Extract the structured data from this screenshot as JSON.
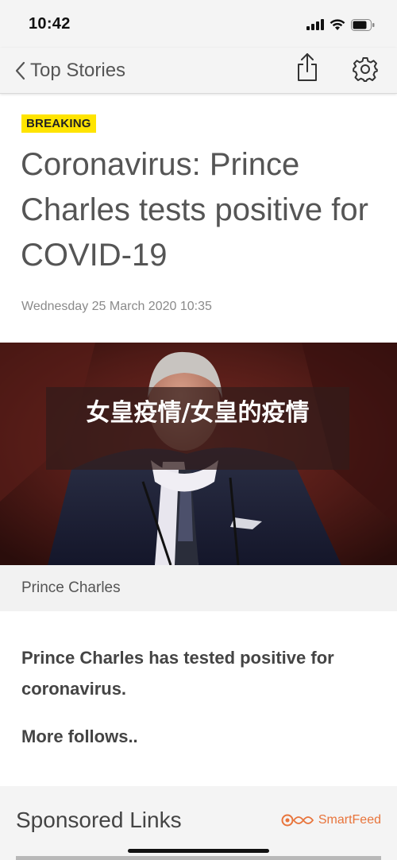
{
  "status_bar": {
    "time": "10:42"
  },
  "nav": {
    "back_label": "Top Stories"
  },
  "article": {
    "badge": "BREAKING",
    "headline": "Coronavirus: Prince Charles tests positive for COVID-19",
    "dateline": "Wednesday 25 March 2020 10:35",
    "image_overlay_text": "女皇疫情/女皇的疫情",
    "image_caption": "Prince Charles",
    "lead": "Prince Charles has tested positive for coronavirus.",
    "more": "More follows.."
  },
  "sponsored": {
    "title": "Sponsored Links",
    "provider": "SmartFeed"
  },
  "colors": {
    "breaking": "#ffe400",
    "smartfeed": "#e8743b",
    "nav_bg": "#f4f4f4"
  }
}
